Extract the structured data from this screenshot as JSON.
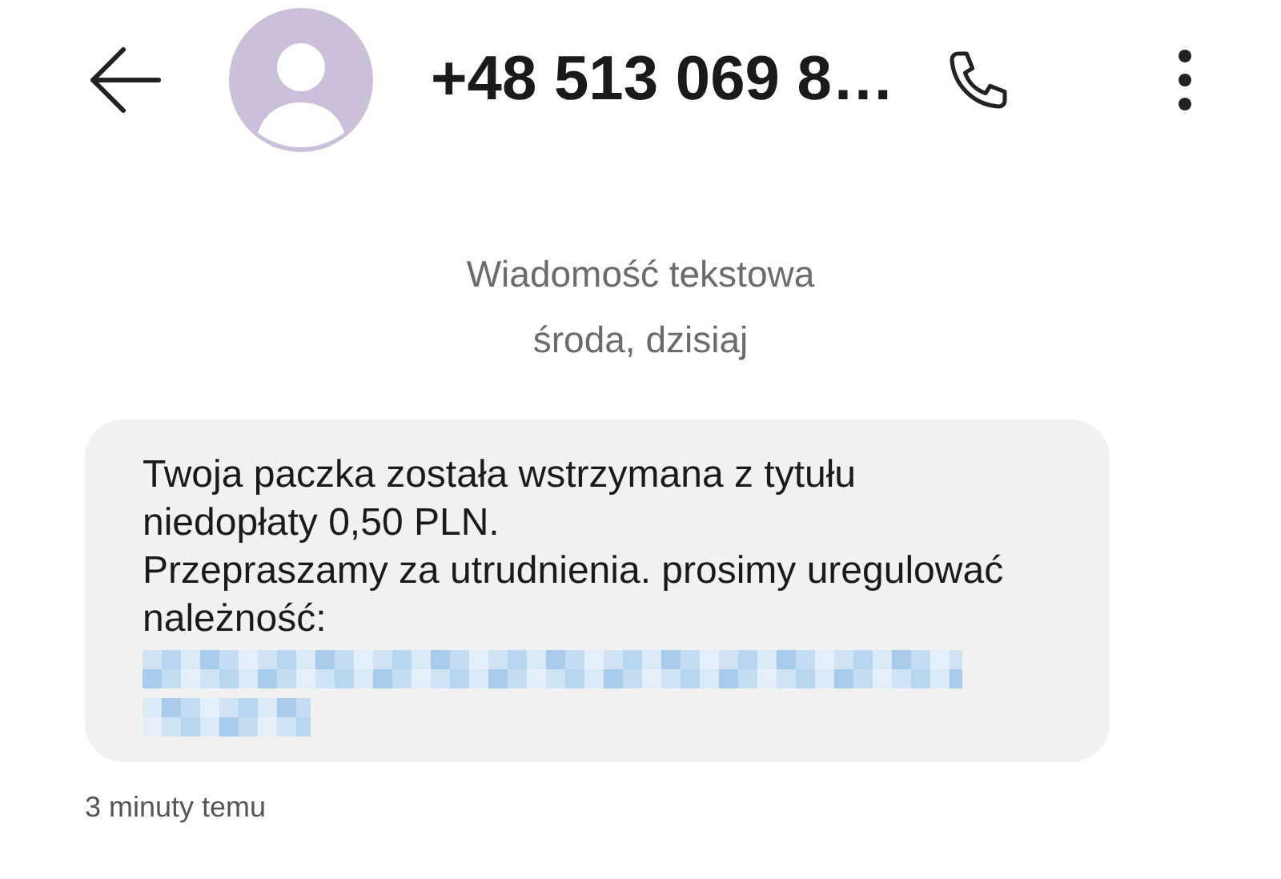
{
  "header": {
    "title": "+48 513 069 8…"
  },
  "thread_info": {
    "type_label": "Wiadomość tekstowa",
    "date_label": "środa, dzisiaj"
  },
  "messages": [
    {
      "text": "Twoja paczka została wstrzymana z tytułu niedopłaty 0,50 PLN.\nPrzepraszamy za utrudnienia. prosimy uregulować należność:",
      "link_redacted": true,
      "time": "3 minuty temu"
    }
  ]
}
